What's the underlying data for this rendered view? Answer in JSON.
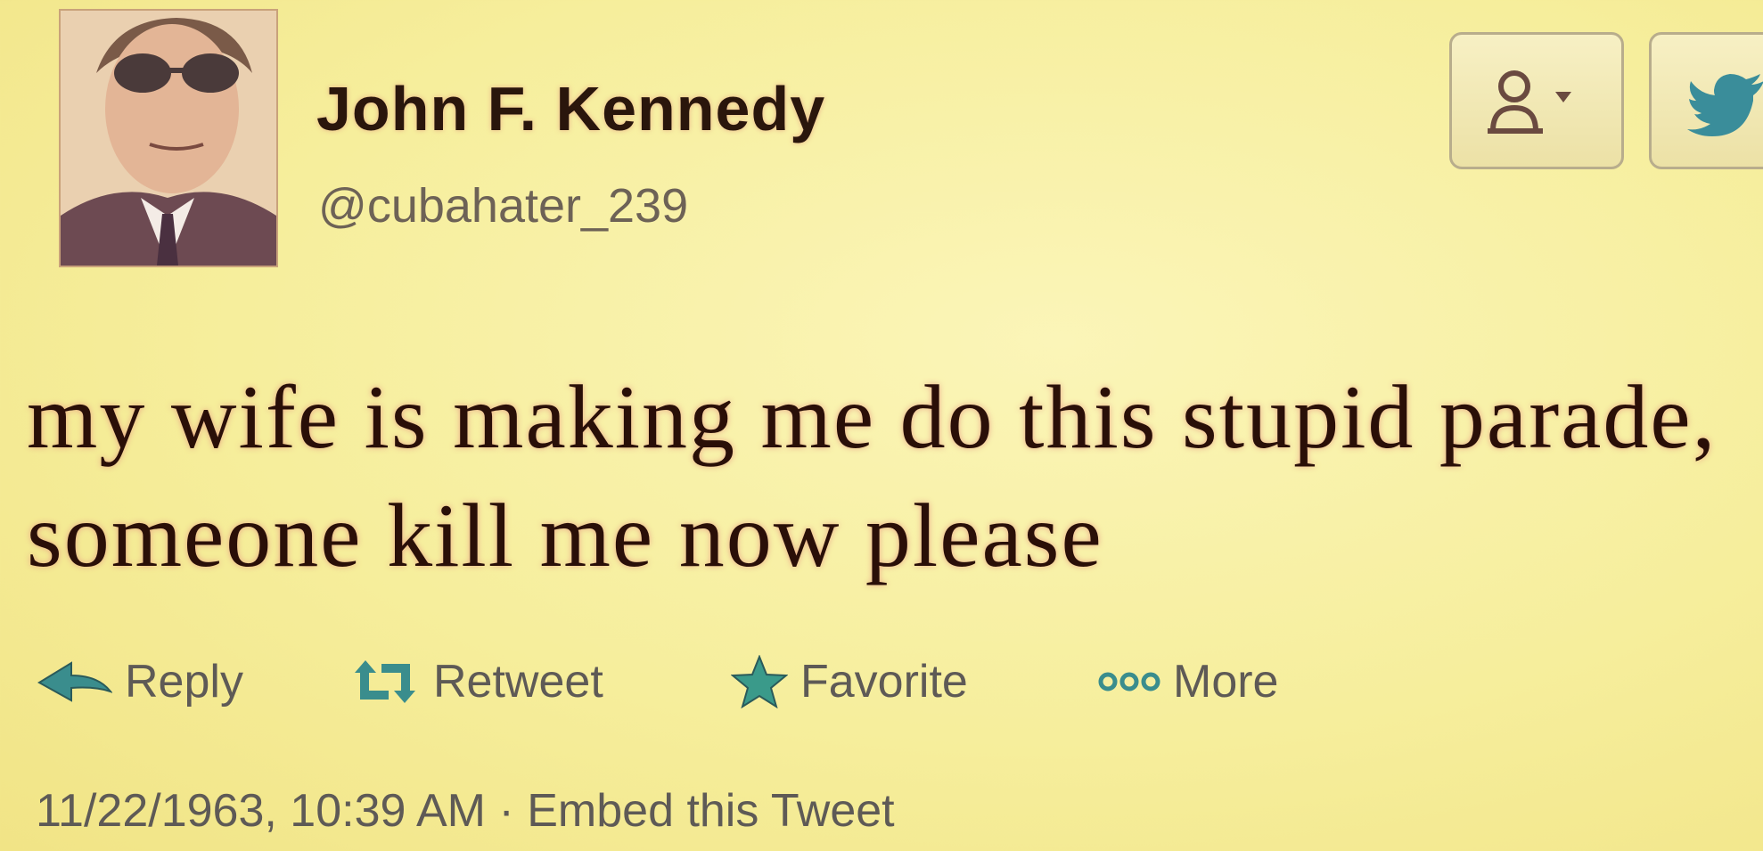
{
  "user": {
    "display_name": "John F. Kennedy",
    "handle": "@cubahater_239"
  },
  "tweet": {
    "text": "my wife is making me do this stupid parade, someone kill me now please"
  },
  "actions": {
    "reply": "Reply",
    "retweet": "Retweet",
    "favorite": "Favorite",
    "more": "More"
  },
  "meta": {
    "timestamp": "11/22/1963, 10:39 AM",
    "separator": "·",
    "embed": "Embed this Tweet"
  },
  "icons": {
    "follow": "person-icon",
    "dropdown": "caret-down-icon",
    "twitter": "twitter-bird-icon",
    "reply": "reply-arrow-icon",
    "retweet": "retweet-icon",
    "favorite": "star-icon",
    "more": "ellipsis-icon"
  },
  "colors": {
    "background": "#f6ee9c",
    "text": "#2a0f08",
    "muted": "#5e5a56",
    "icon_teal": "#3a8d8d"
  }
}
